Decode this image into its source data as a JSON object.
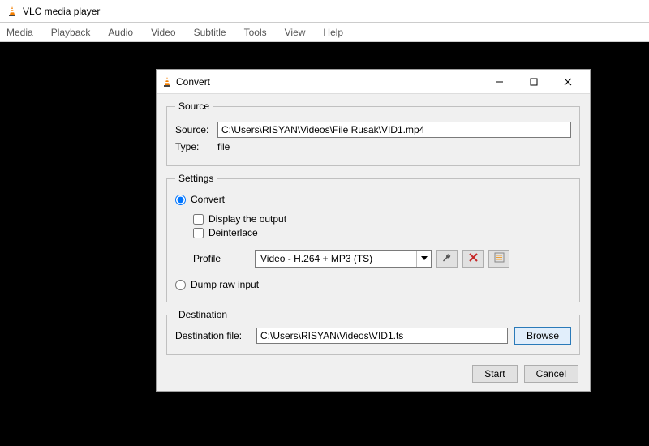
{
  "main": {
    "title": "VLC media player",
    "menu": [
      "Media",
      "Playback",
      "Audio",
      "Video",
      "Subtitle",
      "Tools",
      "View",
      "Help"
    ]
  },
  "dialog": {
    "title": "Convert",
    "source": {
      "legend": "Source",
      "source_label": "Source:",
      "source_value": "C:\\Users\\RISYAN\\Videos\\File Rusak\\VID1.mp4",
      "type_label": "Type:",
      "type_value": "file"
    },
    "settings": {
      "legend": "Settings",
      "convert_label": "Convert",
      "display_output_label": "Display the output",
      "deinterlace_label": "Deinterlace",
      "profile_label": "Profile",
      "profile_value": "Video - H.264 + MP3 (TS)",
      "dump_label": "Dump raw input",
      "convert_checked": true,
      "display_checked": false,
      "deinterlace_checked": false,
      "dump_checked": false
    },
    "destination": {
      "legend": "Destination",
      "dest_label": "Destination file:",
      "dest_value": "C:\\Users\\RISYAN\\Videos\\VID1.ts",
      "browse_label": "Browse"
    },
    "buttons": {
      "start": "Start",
      "cancel": "Cancel"
    }
  }
}
